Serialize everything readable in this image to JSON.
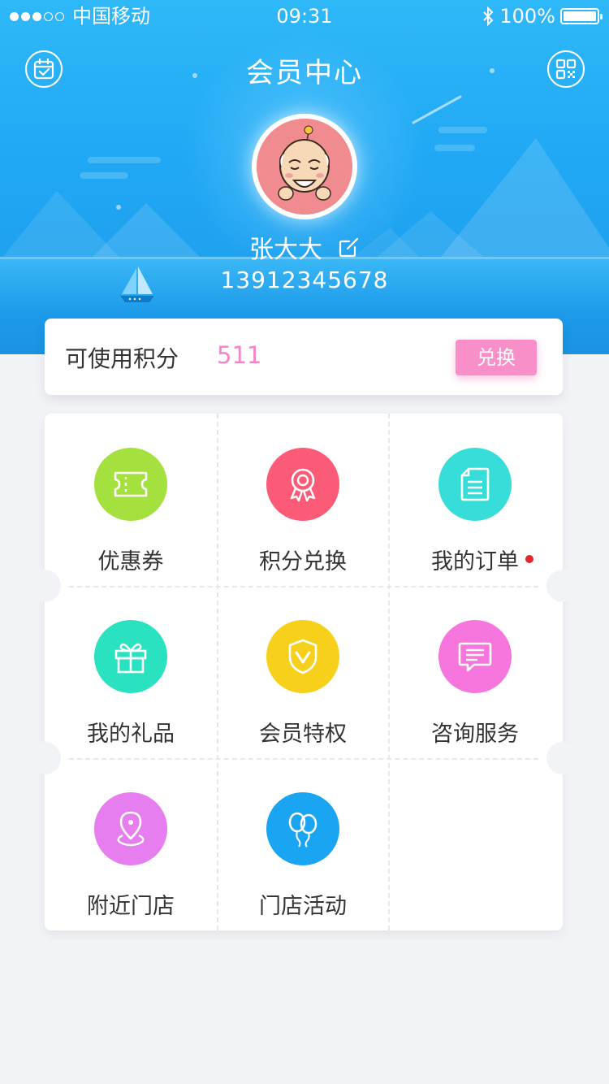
{
  "status_bar": {
    "carrier": "中国移动",
    "time": "09:31",
    "battery": "100%",
    "battery_level": 1.0,
    "signal_strength": 3
  },
  "nav": {
    "title": "会员中心",
    "left_icon": "calendar-check-icon",
    "right_icon": "qr-code-icon"
  },
  "profile": {
    "name": "张大大",
    "phone": "13912345678",
    "edit_icon": "edit-icon"
  },
  "points": {
    "label": "可使用积分",
    "value": "511",
    "button": "兑换"
  },
  "menu": [
    {
      "label": "优惠券",
      "icon": "ticket-icon",
      "color": "#a4e03e",
      "badge": false
    },
    {
      "label": "积分兑换",
      "icon": "medal-icon",
      "color": "#fc5b78",
      "badge": false
    },
    {
      "label": "我的订单",
      "icon": "document-icon",
      "color": "#37ddd9",
      "badge": true
    },
    {
      "label": "我的礼品",
      "icon": "gift-icon",
      "color": "#2ae2c0",
      "badge": false
    },
    {
      "label": "会员特权",
      "icon": "shield-v-icon",
      "color": "#f7d01b",
      "badge": false
    },
    {
      "label": "咨询服务",
      "icon": "message-icon",
      "color": "#f676dd",
      "badge": false
    },
    {
      "label": "附近门店",
      "icon": "location-pin-icon",
      "color": "#e77ef0",
      "badge": false
    },
    {
      "label": "门店活动",
      "icon": "balloon-icon",
      "color": "#1aa5f3",
      "badge": false
    }
  ],
  "colors": {
    "header_blue": "#20a8f4",
    "points_pink": "#f286c7",
    "button_pink": "#f88fc9",
    "badge_red": "#e4262a"
  }
}
